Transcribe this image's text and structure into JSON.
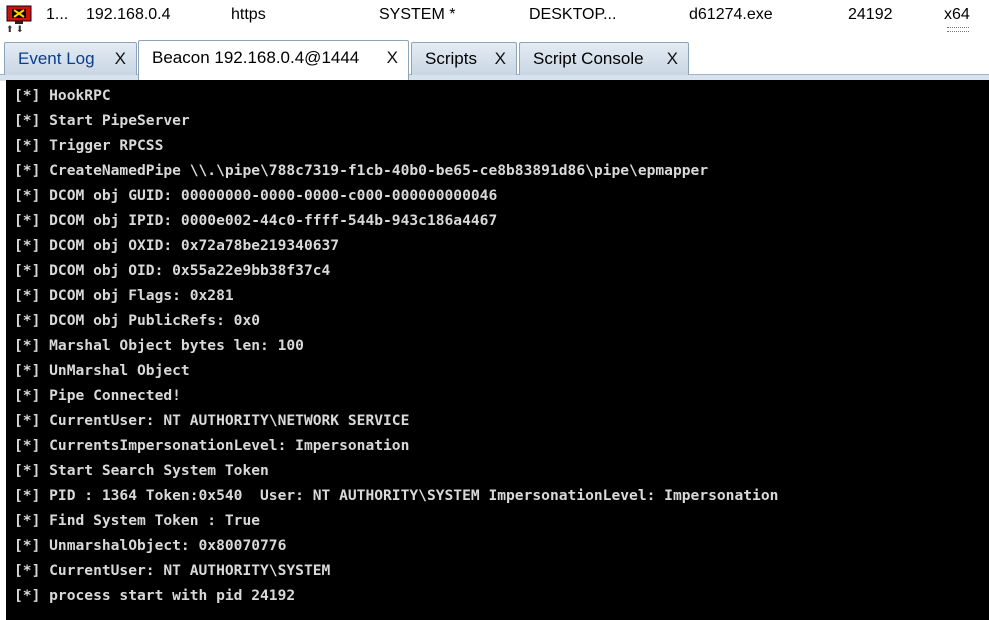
{
  "session_row": {
    "icon": "beacon-computer-icon",
    "id": "1...",
    "internal_ip": "192.168.0.4",
    "listener": "https",
    "user": "SYSTEM *",
    "computer": "DESKTOP...",
    "process": "d61274.exe",
    "pid": "24192",
    "arch": "x64",
    "sort_marker": "⬆ ⬇"
  },
  "tabs": [
    {
      "label": "Event Log",
      "close": "X"
    },
    {
      "label": "Beacon 192.168.0.4@1444",
      "close": "X"
    },
    {
      "label": "Scripts",
      "close": "X"
    },
    {
      "label": "Script Console",
      "close": "X"
    }
  ],
  "console": {
    "lines": [
      "[*] HookRPC",
      "[*] Start PipeServer",
      "[*] Trigger RPCSS",
      "[*] CreateNamedPipe \\\\.\\pipe\\788c7319-f1cb-40b0-be65-ce8b83891d86\\pipe\\epmapper",
      "[*] DCOM obj GUID: 00000000-0000-0000-c000-000000000046",
      "[*] DCOM obj IPID: 0000e002-44c0-ffff-544b-943c186a4467",
      "[*] DCOM obj OXID: 0x72a78be219340637",
      "[*] DCOM obj OID: 0x55a22e9bb38f37c4",
      "[*] DCOM obj Flags: 0x281",
      "[*] DCOM obj PublicRefs: 0x0",
      "[*] Marshal Object bytes len: 100",
      "[*] UnMarshal Object",
      "[*] Pipe Connected!",
      "[*] CurrentUser: NT AUTHORITY\\NETWORK SERVICE",
      "[*] CurrentsImpersonationLevel: Impersonation",
      "[*] Start Search System Token",
      "[*] PID : 1364 Token:0x540  User: NT AUTHORITY\\SYSTEM ImpersonationLevel: Impersonation",
      "[*] Find System Token : True",
      "[*] UnmarshalObject: 0x80070776",
      "[*] CurrentUser: NT AUTHORITY\\SYSTEM",
      "[*] process start with pid 24192"
    ]
  },
  "colors": {
    "console_bg": "#000000",
    "console_fg": "#d9d9d9",
    "tab_bg": "#c9d6e3",
    "event_log_text": "#0b3e8c",
    "beacon_red": "#cc1111"
  }
}
